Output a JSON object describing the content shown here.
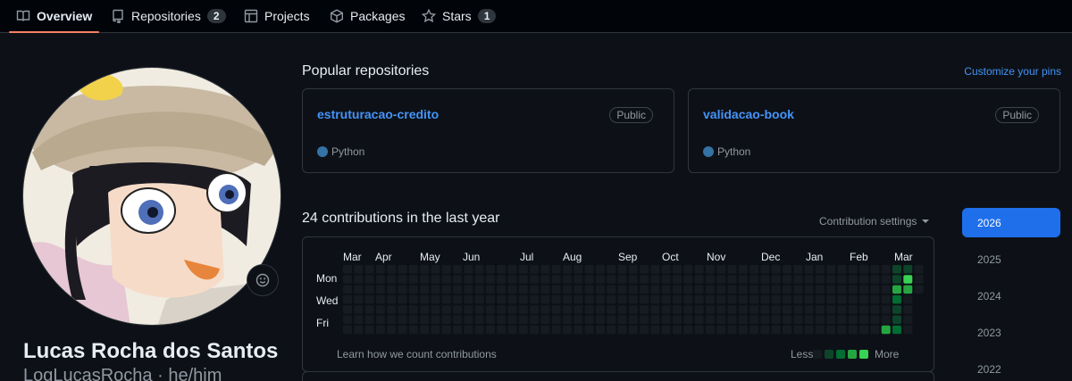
{
  "tabs": [
    {
      "label": "Overview",
      "icon": "book-icon",
      "active": true
    },
    {
      "label": "Repositories",
      "icon": "repo-icon",
      "count": "2"
    },
    {
      "label": "Projects",
      "icon": "table-icon"
    },
    {
      "label": "Packages",
      "icon": "package-icon"
    },
    {
      "label": "Stars",
      "icon": "star-icon",
      "count": "1"
    }
  ],
  "profile": {
    "name": "Lucas Rocha dos Santos",
    "subtitle": "LogLucasRocha · he/him"
  },
  "popular": {
    "title": "Popular repositories",
    "customize": "Customize your pins",
    "repos": [
      {
        "name": "estruturacao-credito",
        "visibility": "Public",
        "language": "Python",
        "language_color": "#3572a5"
      },
      {
        "name": "validacao-book",
        "visibility": "Public",
        "language": "Python",
        "language_color": "#3572a5"
      }
    ]
  },
  "contributions": {
    "title": "24 contributions in the last year",
    "settings": "Contribution settings",
    "months": [
      "Mar",
      "Apr",
      "May",
      "Jun",
      "Jul",
      "Aug",
      "Sep",
      "Oct",
      "Nov",
      "Dec",
      "Jan",
      "Feb",
      "Mar"
    ],
    "days": [
      "Mon",
      "Wed",
      "Fri"
    ],
    "learn": "Learn how we count contributions",
    "less": "Less",
    "more": "More",
    "level_colors": [
      "#161b22",
      "#0e4429",
      "#006d32",
      "#26a641",
      "#39d353"
    ],
    "active_cells": [
      {
        "week": 50,
        "day": 0,
        "level": 1
      },
      {
        "week": 50,
        "day": 1,
        "level": 1
      },
      {
        "week": 50,
        "day": 2,
        "level": 3
      },
      {
        "week": 50,
        "day": 3,
        "level": 2
      },
      {
        "week": 50,
        "day": 4,
        "level": 1
      },
      {
        "week": 50,
        "day": 5,
        "level": 1
      },
      {
        "week": 50,
        "day": 6,
        "level": 2
      },
      {
        "week": 51,
        "day": 0,
        "level": 1
      },
      {
        "week": 51,
        "day": 1,
        "level": 4
      },
      {
        "week": 51,
        "day": 2,
        "level": 3
      },
      {
        "week": 49,
        "day": 6,
        "level": 3
      }
    ]
  },
  "years": [
    "2026",
    "2025",
    "2024",
    "2023",
    "2022"
  ],
  "selected_year": "2026"
}
